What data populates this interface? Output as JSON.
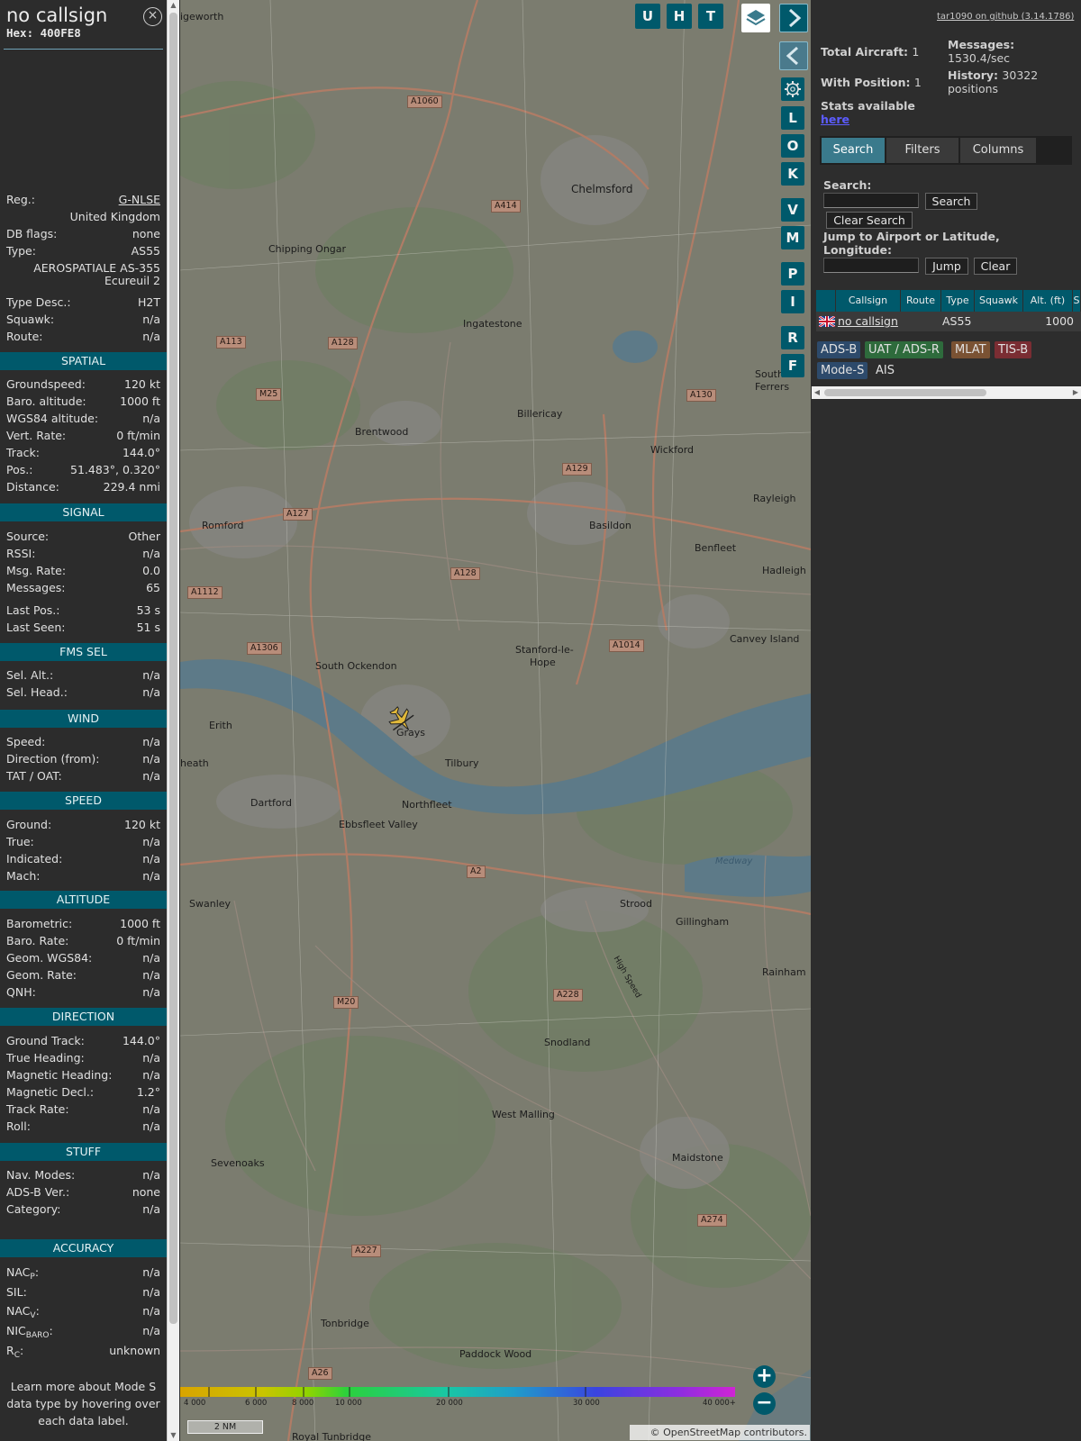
{
  "panel": {
    "title": "no callsign",
    "hex": "Hex: 400FE8",
    "close_glyph": "×",
    "reg": {
      "label": "Reg.:",
      "value": "G-NLSE"
    },
    "country": "United Kingdom",
    "db_flags": {
      "label": "DB flags:",
      "value": "none"
    },
    "type": {
      "label": "Type:",
      "value": "AS55"
    },
    "type_name_1": "AEROSPATIALE AS-355",
    "type_name_2": "Ecureuil 2",
    "type_desc": {
      "label": "Type Desc.:",
      "value": "H2T"
    },
    "squawk": {
      "label": "Squawk:",
      "value": "n/a"
    },
    "route": {
      "label": "Route:",
      "value": "n/a"
    },
    "sections": {
      "spatial": "SPATIAL",
      "signal": "SIGNAL",
      "fms": "FMS SEL",
      "wind": "WIND",
      "speed": "SPEED",
      "altitude": "ALTITUDE",
      "direction": "DIRECTION",
      "stuff": "STUFF",
      "accuracy": "ACCURACY"
    },
    "spatial": [
      {
        "label": "Groundspeed:",
        "value": "120 kt"
      },
      {
        "label": "Baro. altitude:",
        "value": "1000 ft"
      },
      {
        "label": "WGS84 altitude:",
        "value": "n/a"
      },
      {
        "label": "Vert. Rate:",
        "value": "0 ft/min"
      },
      {
        "label": "Track:",
        "value": "144.0°"
      },
      {
        "label": "Pos.:",
        "value": "51.483°, 0.320°"
      },
      {
        "label": "Distance:",
        "value": "229.4 nmi"
      }
    ],
    "signal": [
      {
        "label": "Source:",
        "value": "Other"
      },
      {
        "label": "RSSI:",
        "value": "n/a"
      },
      {
        "label": "Msg. Rate:",
        "value": "0.0"
      },
      {
        "label": "Messages:",
        "value": "65"
      },
      {
        "label": "Last Pos.:",
        "value": "53 s"
      },
      {
        "label": "Last Seen:",
        "value": "51 s"
      }
    ],
    "fms": [
      {
        "label": "Sel. Alt.:",
        "value": "n/a"
      },
      {
        "label": "Sel. Head.:",
        "value": "n/a"
      }
    ],
    "wind": [
      {
        "label": "Speed:",
        "value": "n/a"
      },
      {
        "label": "Direction (from):",
        "value": "n/a"
      },
      {
        "label": "TAT / OAT:",
        "value": "n/a"
      }
    ],
    "speed": [
      {
        "label": "Ground:",
        "value": "120 kt"
      },
      {
        "label": "True:",
        "value": "n/a"
      },
      {
        "label": "Indicated:",
        "value": "n/a"
      },
      {
        "label": "Mach:",
        "value": "n/a"
      }
    ],
    "altitude": [
      {
        "label": "Barometric:",
        "value": "1000 ft"
      },
      {
        "label": "Baro. Rate:",
        "value": "0 ft/min"
      },
      {
        "label": "Geom. WGS84:",
        "value": "n/a"
      },
      {
        "label": "Geom. Rate:",
        "value": "n/a"
      },
      {
        "label": "QNH:",
        "value": "n/a"
      }
    ],
    "direction": [
      {
        "label": "Ground Track:",
        "value": "144.0°"
      },
      {
        "label": "True Heading:",
        "value": "n/a"
      },
      {
        "label": "Magnetic Heading:",
        "value": "n/a"
      },
      {
        "label": "Magnetic Decl.:",
        "value": "1.2°"
      },
      {
        "label": "Track Rate:",
        "value": "n/a"
      },
      {
        "label": "Roll:",
        "value": "n/a"
      }
    ],
    "stuff": [
      {
        "label": "Nav. Modes:",
        "value": "n/a"
      },
      {
        "label": "ADS-B Ver.:",
        "value": "none"
      },
      {
        "label": "Category:",
        "value": "n/a"
      }
    ],
    "accuracy": {
      "nacp": {
        "label": "NAC",
        "sub": "P",
        "value": "n/a"
      },
      "sil": {
        "label": "SIL:",
        "value": "n/a"
      },
      "nacv": {
        "label": "NAC",
        "sub": "V",
        "value": "n/a"
      },
      "nicbaro": {
        "label": "NIC",
        "sub": "BARO",
        "value": "n/a"
      },
      "rc": {
        "label": "R",
        "sub": "C",
        "value": "unknown"
      }
    },
    "footer": [
      "Learn more about Mode S",
      "data type by hovering over",
      "each data label."
    ]
  },
  "map": {
    "buttons": {
      "u": "U",
      "h": "H",
      "t": "T"
    },
    "side_buttons": [
      "L",
      "O",
      "K",
      "V",
      "M",
      "P",
      "I",
      "R",
      "F"
    ],
    "zoom_in": "+",
    "zoom_out": "−",
    "legend": [
      "4 000",
      "6 000",
      "8 000",
      "10 000",
      "20 000",
      "30 000",
      "40 000+"
    ],
    "scale": "2 NM",
    "attribution": "© OpenStreetMap contributors.",
    "places": [
      {
        "t": "Chelmsford"
      },
      {
        "t": "Chipping Ongar"
      },
      {
        "t": "Ingatestone"
      },
      {
        "t": "Billericay"
      },
      {
        "t": "Brentwood"
      },
      {
        "t": "Wickford"
      },
      {
        "t": "Rayleigh"
      },
      {
        "t": "Basildon"
      },
      {
        "t": "Benfleet"
      },
      {
        "t": "Hadleigh"
      },
      {
        "t": "Romford"
      },
      {
        "t": "Canvey Island"
      },
      {
        "t": "Stanford-le-"
      },
      {
        "t": "Hope"
      },
      {
        "t": "South Ockendon"
      },
      {
        "t": "Erith"
      },
      {
        "t": "Grays"
      },
      {
        "t": "Tilbury"
      },
      {
        "t": "Dartford"
      },
      {
        "t": "Northfleet"
      },
      {
        "t": "Ebbsfleet Valley"
      },
      {
        "t": "Swanley"
      },
      {
        "t": "Strood"
      },
      {
        "t": "Gillingham"
      },
      {
        "t": "Rainham"
      },
      {
        "t": "Snodland"
      },
      {
        "t": "West Malling"
      },
      {
        "t": "Maidstone"
      },
      {
        "t": "Sevenoaks"
      },
      {
        "t": "Tonbridge"
      },
      {
        "t": "Paddock Wood"
      },
      {
        "t": "Royal Tunbridge"
      },
      {
        "t": "South"
      },
      {
        "t": "Ferrers"
      },
      {
        "t": "igeworth"
      },
      {
        "t": "heath"
      },
      {
        "t": "Medway"
      },
      {
        "t": "High Speed"
      }
    ],
    "roads": [
      "A1060",
      "A414",
      "A113",
      "A128",
      "M25",
      "A130",
      "A129",
      "A127",
      "A128",
      "A1112",
      "A1306",
      "A1014",
      "A2",
      "M20",
      "A228",
      "A227",
      "A274",
      "A26"
    ]
  },
  "right": {
    "github": "tar1090 on github (3.14.1786)",
    "total_label": "Total Aircraft:",
    "total": "1",
    "withpos_label": "With Position:",
    "withpos": "1",
    "messages_label": "Messages:",
    "messages": "1530.4/sec",
    "history_label": "History:",
    "history_1": "30322",
    "history_2": "positions",
    "stats_label": "Stats available",
    "stats_link": "here",
    "tabs": [
      "Search",
      "Filters",
      "Columns"
    ],
    "search_label": "Search:",
    "search_btn": "Search",
    "clear_search_btn": "Clear Search",
    "jump_label_1": "Jump to Airport or Latitude,",
    "jump_label_2": "Longitude:",
    "jump_btn": "Jump",
    "clear_btn": "Clear",
    "columns": [
      "Callsign",
      "Route",
      "Type",
      "Squawk",
      "Alt. (ft)",
      "S"
    ],
    "row": {
      "callsign": "no callsign",
      "route": "",
      "type": "AS55",
      "squawk": "",
      "alt": "1000"
    },
    "chips": [
      {
        "t": "ADS-B",
        "bg": "#2d4a6b",
        "fg": "#e0e0e0"
      },
      {
        "t": "UAT / ADS-R",
        "bg": "#2e6b3c",
        "fg": "#e0e0e0"
      },
      {
        "t": "MLAT",
        "bg": "#7a5233",
        "fg": "#e0e0e0"
      },
      {
        "t": "TIS-B",
        "bg": "#7a2d33",
        "fg": "#e0e0e0"
      },
      {
        "t": "Mode-S",
        "bg": "#2d4a6b",
        "fg": "#e0e0e0"
      },
      {
        "t": "AIS",
        "bg": "transparent",
        "fg": "#e0e0e0"
      }
    ]
  }
}
